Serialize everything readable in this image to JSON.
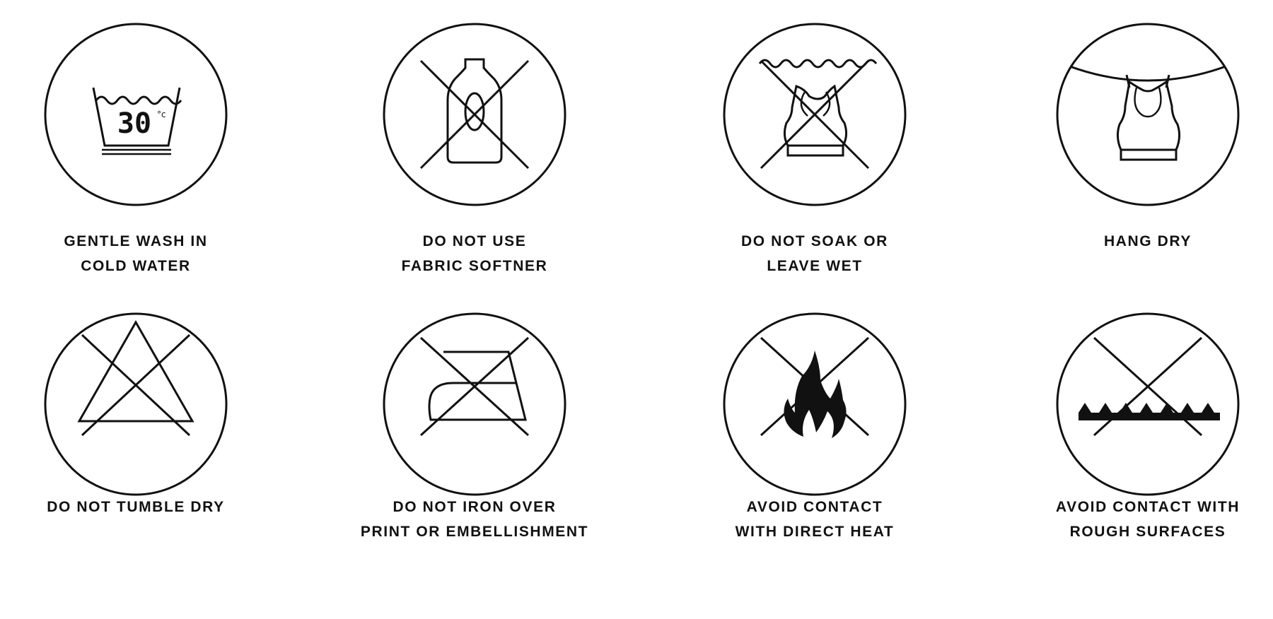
{
  "care_instructions": [
    {
      "icon": "wash-30-icon",
      "lines": [
        "GENTLE WASH IN",
        "COLD WATER"
      ],
      "temp_value": "30",
      "temp_unit": "°c"
    },
    {
      "icon": "no-fabric-softener-icon",
      "lines": [
        "DO NOT USE",
        "FABRIC SOFTNER"
      ]
    },
    {
      "icon": "no-soak-icon",
      "lines": [
        "DO NOT SOAK OR",
        "LEAVE WET"
      ]
    },
    {
      "icon": "hang-dry-icon",
      "lines": [
        "HANG DRY"
      ]
    },
    {
      "icon": "no-tumble-dry-icon",
      "lines": [
        "DO NOT TUMBLE DRY"
      ]
    },
    {
      "icon": "no-iron-icon",
      "lines": [
        "DO NOT IRON OVER",
        "PRINT OR EMBELLISHMENT"
      ]
    },
    {
      "icon": "no-direct-heat-icon",
      "lines": [
        "AVOID CONTACT",
        "WITH DIRECT HEAT"
      ]
    },
    {
      "icon": "no-rough-surfaces-icon",
      "lines": [
        "AVOID CONTACT WITH",
        "ROUGH SURFACES"
      ]
    }
  ]
}
